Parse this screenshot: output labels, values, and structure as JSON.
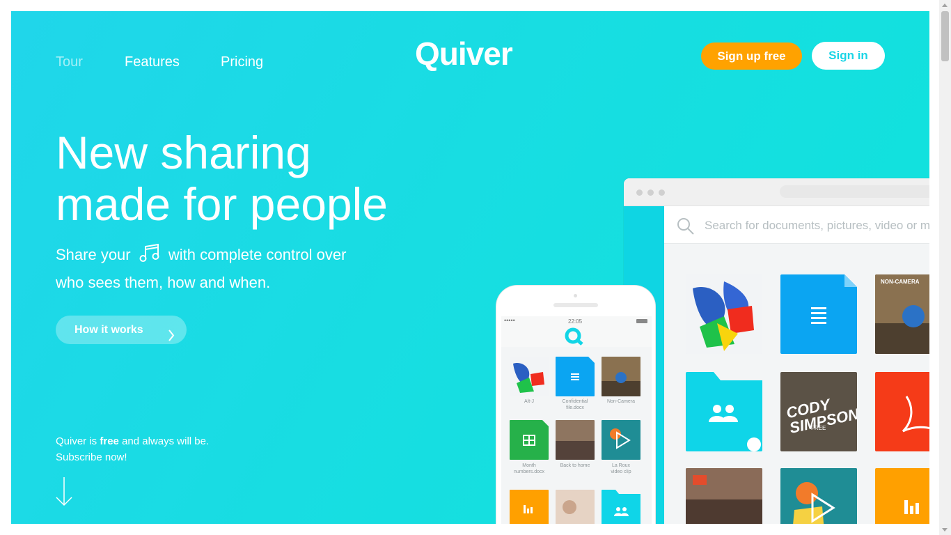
{
  "nav": {
    "tour": "Tour",
    "features": "Features",
    "pricing": "Pricing"
  },
  "logo": "Quiver",
  "buttons": {
    "signup": "Sign up free",
    "signin": "Sign in",
    "how": "How it works"
  },
  "hero": {
    "line1": "New sharing",
    "line2": "made for people",
    "sub_before": "Share your",
    "sub_after": "with complete control over",
    "sub_line2": "who sees them, how and when."
  },
  "footer": {
    "prefix": "Quiver is",
    "bold": "free",
    "suffix": "and always will be.",
    "line2": "Subscribe now!"
  },
  "desktop_app": {
    "search_placeholder": "Search for documents, pictures, video or m",
    "tile_texts": {
      "noncamera": "NON-CAMERA",
      "cody": "CODY SIMPSON",
      "free": "FREE"
    }
  },
  "phone_app": {
    "time": "22:05",
    "carrier": "•••••",
    "labels": {
      "altj": "Alt-J",
      "confidential_line1": "Confidential",
      "confidential_line2": "file.docx",
      "noncamera": "Non-Camera",
      "month_line1": "Month",
      "month_line2": "numbers.docx",
      "back_home": "Back to home",
      "laroux_line1": "La Roux",
      "laroux_line2": "video clip"
    }
  },
  "colors": {
    "brand": "#1bd5e6",
    "orange": "#ffa200",
    "doc_blue": "#0ba5f2",
    "folder_cyan": "#0fd5e8",
    "pdf_red": "#f53b18",
    "sheet_green": "#26b14a",
    "chart_orange": "#ffa000"
  }
}
